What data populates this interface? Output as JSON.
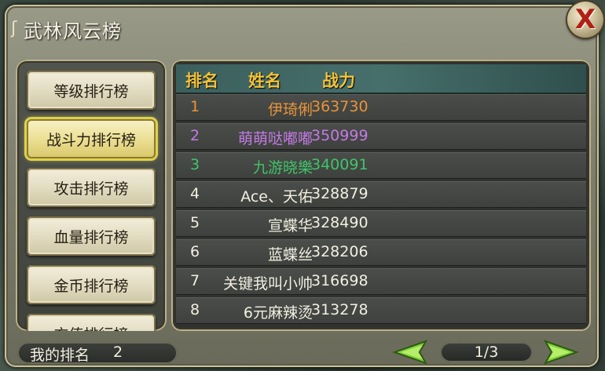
{
  "title": "武林风云榜",
  "close_glyph": "X",
  "nav": [
    {
      "label": "等级排行榜",
      "active": false
    },
    {
      "label": "战斗力排行榜",
      "active": true
    },
    {
      "label": "攻击排行榜",
      "active": false
    },
    {
      "label": "血量排行榜",
      "active": false
    },
    {
      "label": "金币排行榜",
      "active": false
    },
    {
      "label": "充值排行榜",
      "active": false
    }
  ],
  "table": {
    "headers": {
      "rank": "排名",
      "name": "姓名",
      "power": "战力"
    },
    "rows": [
      {
        "rank": "1",
        "name": "伊琦俐",
        "power": "363730",
        "color": "#e8933a"
      },
      {
        "rank": "2",
        "name": "萌萌哒嘟嘟",
        "power": "350999",
        "color": "#c37ae6"
      },
      {
        "rank": "3",
        "name": "九游晓樂",
        "power": "340091",
        "color": "#3fc46a"
      },
      {
        "rank": "4",
        "name": "Ace、天佑",
        "power": "328879",
        "color": "#f2efe2"
      },
      {
        "rank": "5",
        "name": "宣蝶华",
        "power": "328490",
        "color": "#f2efe2"
      },
      {
        "rank": "6",
        "name": "蓝蝶丝",
        "power": "328206",
        "color": "#f2efe2"
      },
      {
        "rank": "7",
        "name": "关键我叫小帅",
        "power": "316698",
        "color": "#f2efe2"
      },
      {
        "rank": "8",
        "name": "6元麻辣烫",
        "power": "313278",
        "color": "#f2efe2"
      }
    ]
  },
  "footer": {
    "my_rank_label": "我的排名",
    "my_rank_value": "2",
    "page": "1/3"
  },
  "colors": {
    "header_text": "#f2c23a",
    "active_nav_glow": "#e0d14a",
    "arrow_green": "#7fcf3a"
  }
}
